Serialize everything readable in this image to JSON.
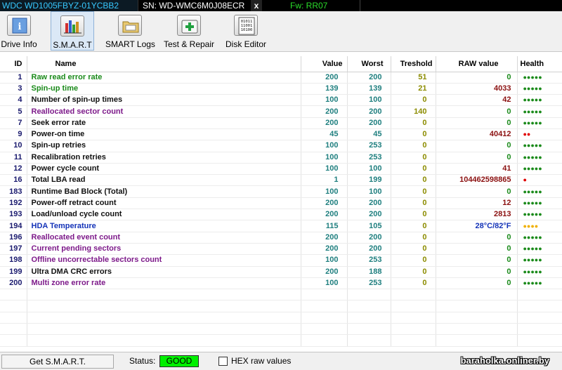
{
  "infobar": {
    "model": "WDC WD1005FBYZ-01YCBB2",
    "serial": "SN: WD-WMC6M0J08ECR",
    "close": "x",
    "firmware": "Fw: RR07"
  },
  "toolbar": {
    "buttons": [
      {
        "label": "Drive Info",
        "icon": "info-icon"
      },
      {
        "label": "S.M.A.R.T",
        "icon": "smart-icon"
      },
      {
        "label": "SMART Logs",
        "icon": "logs-folder-icon"
      },
      {
        "label": "Test & Repair",
        "icon": "first-aid-icon"
      },
      {
        "label": "Disk Editor",
        "icon": "binary-disk-icon"
      }
    ]
  },
  "table": {
    "headers": [
      "ID",
      "Name",
      "Value",
      "Worst",
      "Treshold",
      "RAW value",
      "Health"
    ],
    "rows": [
      {
        "id": "1",
        "name": "Raw read error rate",
        "value": "200",
        "worst": "200",
        "treshold": "51",
        "raw": "0",
        "health": "●●●●●"
      },
      {
        "id": "3",
        "name": "Spin-up time",
        "value": "139",
        "worst": "139",
        "treshold": "21",
        "raw": "4033",
        "health": "●●●●●"
      },
      {
        "id": "4",
        "name": "Number of spin-up times",
        "value": "100",
        "worst": "100",
        "treshold": "0",
        "raw": "42",
        "health": "●●●●●"
      },
      {
        "id": "5",
        "name": "Reallocated sector count",
        "value": "200",
        "worst": "200",
        "treshold": "140",
        "raw": "0",
        "health": "●●●●●"
      },
      {
        "id": "7",
        "name": "Seek error rate",
        "value": "200",
        "worst": "200",
        "treshold": "0",
        "raw": "0",
        "health": "●●●●●"
      },
      {
        "id": "9",
        "name": "Power-on time",
        "value": "45",
        "worst": "45",
        "treshold": "0",
        "raw": "40412",
        "health": "●●"
      },
      {
        "id": "10",
        "name": "Spin-up retries",
        "value": "100",
        "worst": "253",
        "treshold": "0",
        "raw": "0",
        "health": "●●●●●"
      },
      {
        "id": "11",
        "name": "Recalibration retries",
        "value": "100",
        "worst": "253",
        "treshold": "0",
        "raw": "0",
        "health": "●●●●●"
      },
      {
        "id": "12",
        "name": "Power cycle count",
        "value": "100",
        "worst": "100",
        "treshold": "0",
        "raw": "41",
        "health": "●●●●●"
      },
      {
        "id": "16",
        "name": "Total LBA read",
        "value": "1",
        "worst": "199",
        "treshold": "0",
        "raw": "104462598865",
        "health": "●"
      },
      {
        "id": "183",
        "name": "Runtime Bad Block (Total)",
        "value": "100",
        "worst": "100",
        "treshold": "0",
        "raw": "0",
        "health": "●●●●●"
      },
      {
        "id": "192",
        "name": "Power-off retract count",
        "value": "200",
        "worst": "200",
        "treshold": "0",
        "raw": "12",
        "health": "●●●●●"
      },
      {
        "id": "193",
        "name": "Load/unload cycle count",
        "value": "200",
        "worst": "200",
        "treshold": "0",
        "raw": "2813",
        "health": "●●●●●"
      },
      {
        "id": "194",
        "name": "HDA Temperature",
        "value": "115",
        "worst": "105",
        "treshold": "0",
        "raw": "28°C/82°F",
        "health": "●●●●"
      },
      {
        "id": "196",
        "name": "Reallocated event count",
        "value": "200",
        "worst": "200",
        "treshold": "0",
        "raw": "0",
        "health": "●●●●●"
      },
      {
        "id": "197",
        "name": "Current pending sectors",
        "value": "200",
        "worst": "200",
        "treshold": "0",
        "raw": "0",
        "health": "●●●●●"
      },
      {
        "id": "198",
        "name": "Offline uncorrectable sectors count",
        "value": "100",
        "worst": "253",
        "treshold": "0",
        "raw": "0",
        "health": "●●●●●"
      },
      {
        "id": "199",
        "name": "Ultra DMA CRC errors",
        "value": "200",
        "worst": "188",
        "treshold": "0",
        "raw": "0",
        "health": "●●●●●"
      },
      {
        "id": "200",
        "name": "Multi zone error rate",
        "value": "100",
        "worst": "253",
        "treshold": "0",
        "raw": "0",
        "health": "●●●●●"
      }
    ]
  },
  "colors": {
    "name_green": "#1a8a1a",
    "name_purple": "#7d1a8a",
    "name_blue": "#1433b8",
    "health_green": "#1a8a1a",
    "health_red": "#e00000",
    "health_yellow": "#f0b000",
    "status_good": "#00f000"
  },
  "statusbar": {
    "get_button": "Get S.M.A.R.T.",
    "status_label": "Status:",
    "status_value": "GOOD",
    "hex_label": "HEX raw values",
    "watermark": "baraholka.onliner.by"
  }
}
